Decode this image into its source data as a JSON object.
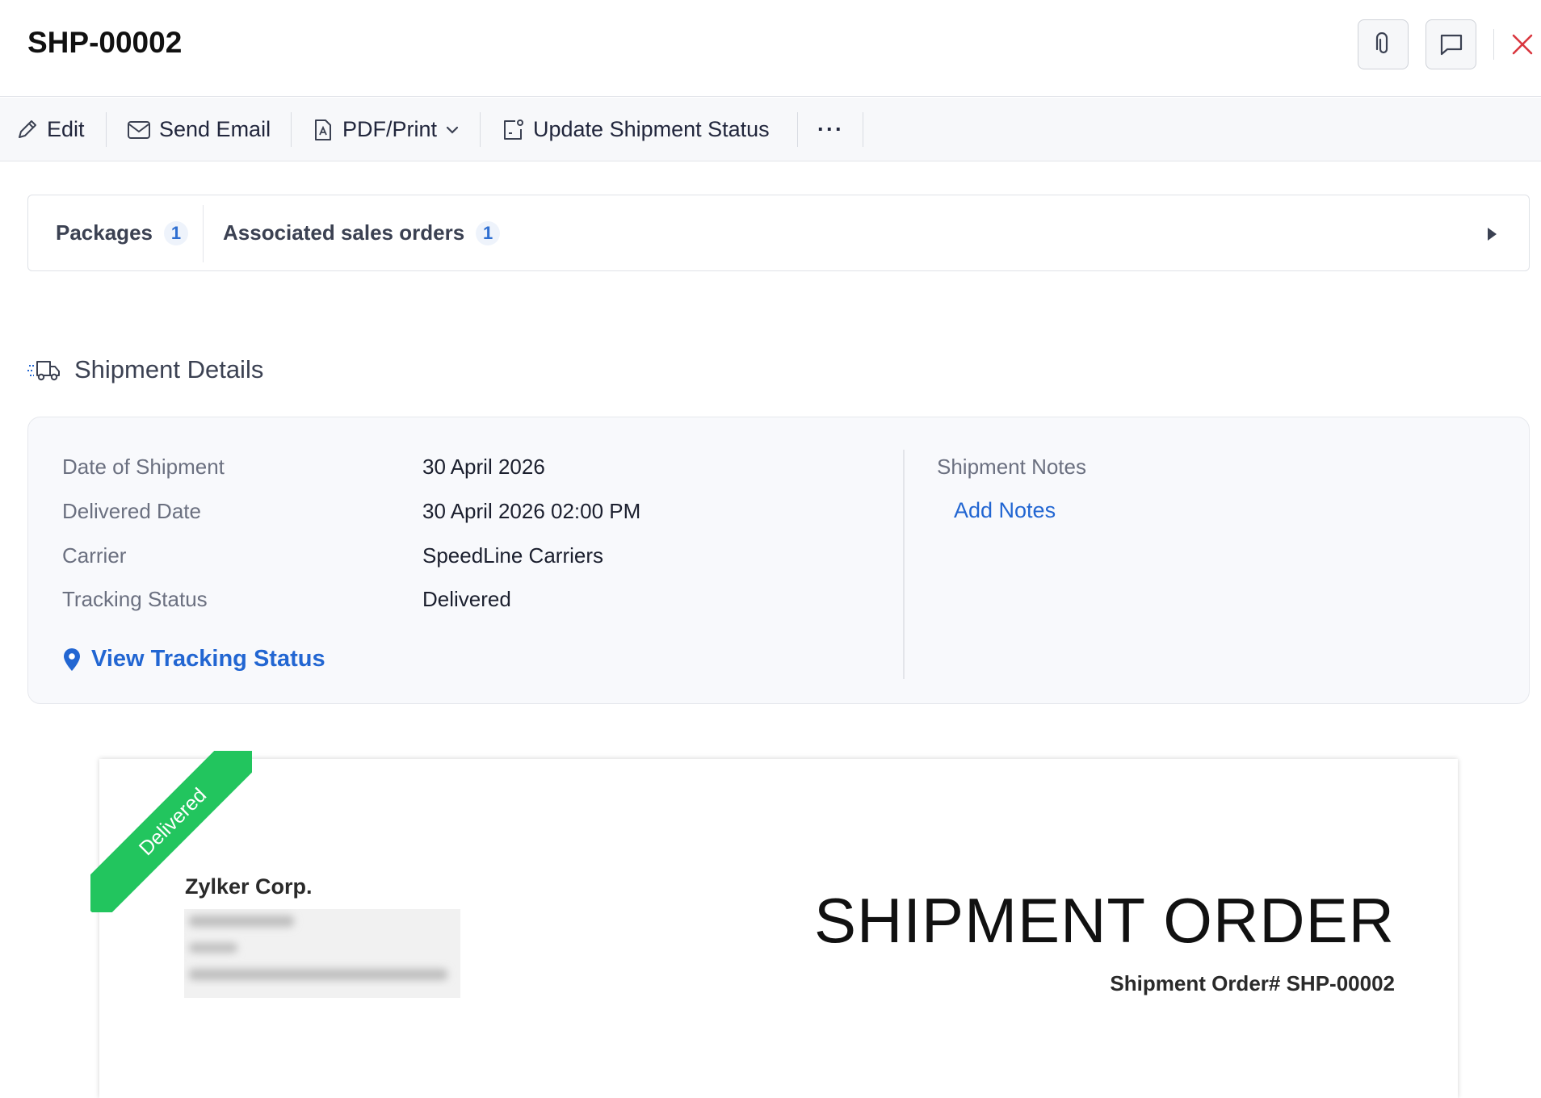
{
  "header": {
    "title": "SHP-00002"
  },
  "toolbar": {
    "edit": "Edit",
    "send_email": "Send Email",
    "pdf_print": "PDF/Print",
    "update_status": "Update Shipment Status",
    "more": "···"
  },
  "tabs": [
    {
      "label": "Packages",
      "count": "1"
    },
    {
      "label": "Associated sales orders",
      "count": "1"
    }
  ],
  "section": {
    "title": "Shipment Details"
  },
  "details": {
    "rows": [
      {
        "label": "Date of Shipment",
        "value": "30 April 2026"
      },
      {
        "label": "Delivered Date",
        "value": "30 April 2026 02:00 PM"
      },
      {
        "label": "Carrier",
        "value": "SpeedLine Carriers"
      },
      {
        "label": "Tracking Status",
        "value": "Delivered"
      }
    ],
    "tracking_link": "View Tracking Status",
    "notes_label": "Shipment Notes",
    "notes_link": "Add Notes"
  },
  "document": {
    "ribbon": "Delivered",
    "company": "Zylker Corp.",
    "title": "SHIPMENT ORDER",
    "number": "Shipment Order# SHP-00002"
  },
  "colors": {
    "accent": "#2266d2",
    "ribbon": "#22c55e",
    "close": "#d9363e"
  }
}
